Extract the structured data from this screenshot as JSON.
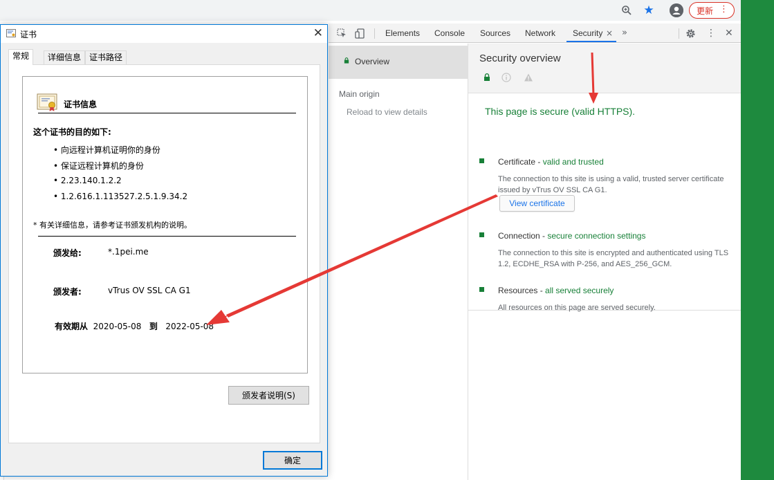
{
  "browser": {
    "update_label": "更新",
    "update_menu": "⋮",
    "icons": [
      "zoom-icon",
      "star-icon",
      "account-icon"
    ]
  },
  "devtools": {
    "tabs": [
      "Elements",
      "Console",
      "Sources",
      "Network",
      "Security"
    ],
    "active_tab": "Security",
    "close_tab": "×",
    "more_tabs": "»",
    "nav": {
      "overview": "Overview",
      "main_origin": "Main origin",
      "reload": "Reload to view details"
    },
    "security": {
      "title": "Security overview",
      "secure_message": "This page is secure (valid HTTPS).",
      "certificate": {
        "label": "Certificate - ",
        "status": "valid and trusted",
        "desc": "The connection to this site is using a valid, trusted server certificate issued by vTrus OV SSL CA G1.",
        "button": "View certificate"
      },
      "connection": {
        "label": "Connection - ",
        "status": "secure connection settings",
        "desc": "The connection to this site is encrypted and authenticated using TLS 1.2, ECDHE_RSA with P-256, and AES_256_GCM."
      },
      "resources": {
        "label": "Resources - ",
        "status": "all served securely",
        "desc": "All resources on this page are served securely."
      },
      "colors": {
        "secure_green": "#188038",
        "link_blue": "#1a73e8"
      }
    }
  },
  "cert_dialog": {
    "title": "证书",
    "close": "✕",
    "tabs": [
      "常规",
      "详细信息",
      "证书路径"
    ],
    "info_title": "证书信息",
    "purpose_heading": "这个证书的目的如下:",
    "purposes": [
      "• 向远程计算机证明你的身份",
      "• 保证远程计算机的身份",
      "• 2.23.140.1.2.2",
      "• 1.2.616.1.113527.2.5.1.9.34.2"
    ],
    "detail_note": "* 有关详细信息，请参考证书颁发机构的说明。",
    "issued_to_label": "颁发给:",
    "issued_to": "*.1pei.me",
    "issued_by_label": "颁发者:",
    "issued_by": "vTrus OV SSL CA G1",
    "valid_from_label": "有效期从",
    "valid_from": "2020-05-08",
    "valid_to_label": "到",
    "valid_to": "2022-05-08",
    "issuer_statement_button": "颁发者说明(S)",
    "ok_button": "确定"
  },
  "annotation_color": "#e53935",
  "accent_green": "#1e8a3e"
}
